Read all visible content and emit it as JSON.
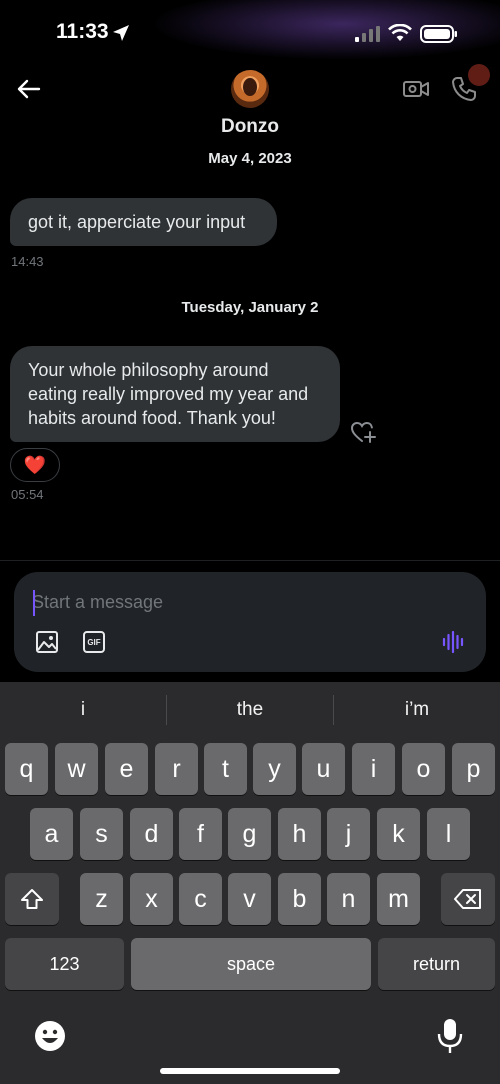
{
  "status_bar": {
    "time": "11:33"
  },
  "header": {
    "contact_name": "Donzo"
  },
  "conversation": {
    "groups": [
      {
        "date": "May 4, 2023",
        "message": "got it, apperciate your input",
        "time": "14:43"
      },
      {
        "date": "Tuesday, January 2",
        "message": "Your whole philosophy around eating really improved my year and habits around food. Thank you!",
        "time": "05:54",
        "reaction": "❤️"
      }
    ]
  },
  "composer": {
    "placeholder": "Start a message",
    "gif_label": "GIF"
  },
  "keyboard": {
    "suggestions": [
      "i",
      "the",
      "i’m"
    ],
    "row1": [
      "q",
      "w",
      "e",
      "r",
      "t",
      "y",
      "u",
      "i",
      "o",
      "p"
    ],
    "row2": [
      "a",
      "s",
      "d",
      "f",
      "g",
      "h",
      "j",
      "k",
      "l"
    ],
    "row3": [
      "z",
      "x",
      "c",
      "v",
      "b",
      "n",
      "m"
    ],
    "numbers_label": "123",
    "space_label": "space",
    "return_label": "return"
  },
  "colors": {
    "accent": "#7856ff",
    "bubble": "#2f3336",
    "keyboard_bg": "#2b2b2d",
    "key": "#6a6a6c"
  }
}
